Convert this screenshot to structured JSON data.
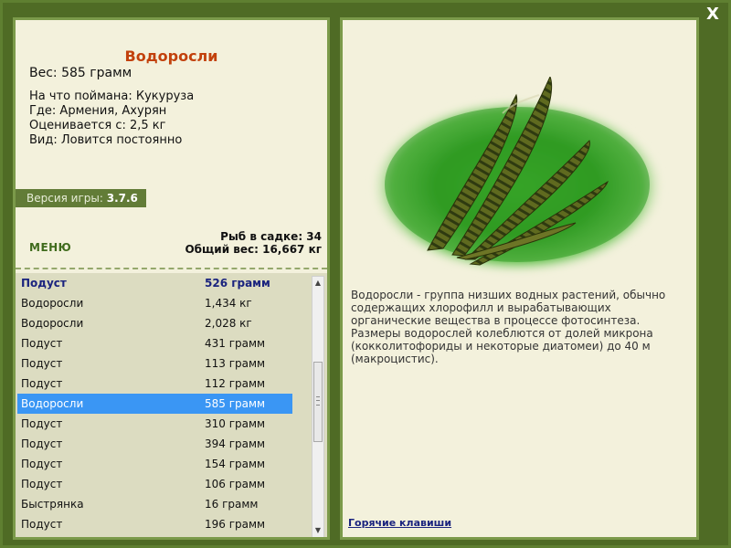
{
  "window": {
    "close_label": "X"
  },
  "fish": {
    "title": "Водоросли",
    "weight": "Вес: 585 грамм",
    "caught_on": "На что поймана: Кукуруза",
    "location": "Где: Армения, Ахурян",
    "valued_from": "Оценивается с: 2,5 кг",
    "availability": "Вид: Ловится постоянно"
  },
  "version": {
    "label": "Версия игры:",
    "value": "3.7.6"
  },
  "menu": {
    "label": "МЕНЮ"
  },
  "stats": {
    "fish_in_net": "Рыб в садке: 34",
    "total_weight": "Общий вес: 16,667 кг"
  },
  "catch_list": [
    {
      "name": "Подуст",
      "weight": "526 грамм"
    },
    {
      "name": "Водоросли",
      "weight": "1,434 кг"
    },
    {
      "name": "Водоросли",
      "weight": "2,028 кг"
    },
    {
      "name": "Подуст",
      "weight": "431 грамм"
    },
    {
      "name": "Подуст",
      "weight": "113 грамм"
    },
    {
      "name": "Подуст",
      "weight": "112 грамм"
    },
    {
      "name": "Водоросли",
      "weight": "585 грамм"
    },
    {
      "name": "Подуст",
      "weight": "310 грамм"
    },
    {
      "name": "Подуст",
      "weight": "394 грамм"
    },
    {
      "name": "Подуст",
      "weight": "154 грамм"
    },
    {
      "name": "Подуст",
      "weight": "106 грамм"
    },
    {
      "name": "Быстрянка",
      "weight": "16 грамм"
    },
    {
      "name": "Подуст",
      "weight": "196 грамм"
    }
  ],
  "description": "Водоросли - группа низших водных растений, обычно содержащих хлорофилл и вырабатывающих органические вещества в процессе фотосинтеза. Размеры водорослей колеблются от долей микрона (кокколитофориды и некоторые диатомеи) до 40 м (макроцистис).",
  "hotkeys": {
    "label": "Горячие клавиши"
  },
  "scroll": {
    "up_icon": "▲",
    "down_icon": "▼"
  },
  "colors": {
    "frame": "#5f7f31",
    "panel": "#f3f1dc",
    "title": "#c2410c",
    "selected_row": "#3a96f4",
    "highlight_row": "#1a237e"
  }
}
